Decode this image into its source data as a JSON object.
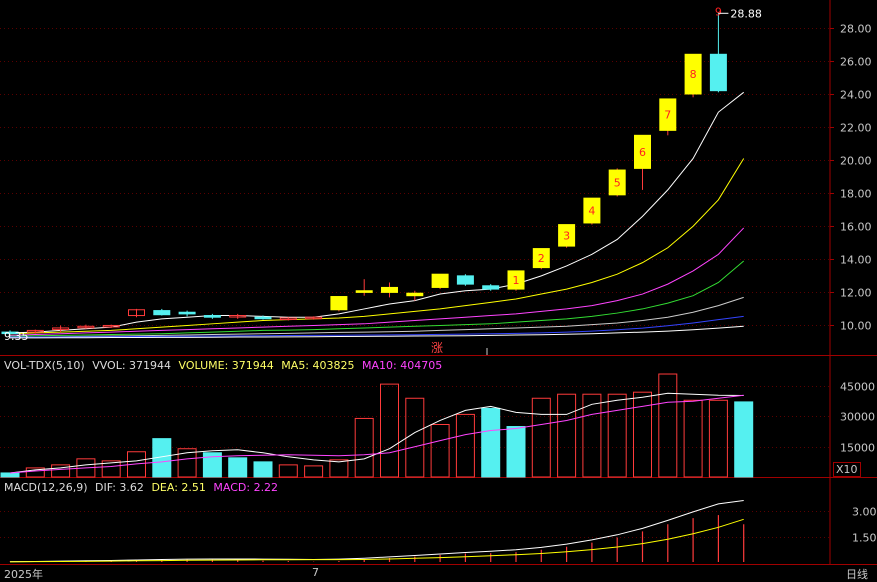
{
  "colors": {
    "up": "#ff3b3b",
    "down": "#55f0f0",
    "upFill": "#ffff00",
    "ma1": "#ffffff",
    "ma2": "#ffff00",
    "ma3": "#ff44ff",
    "ma4": "#33dd33",
    "ma5": "#cccccc",
    "ma6": "#3344ff",
    "grid": "#5a0000",
    "frame": "#a00000",
    "macdDif": "#ffffff",
    "macdDea": "#ffff00",
    "macdBar": "#ff3b3b"
  },
  "price": {
    "high_label": "28.88",
    "low_label": "9.35",
    "ticks": [
      "28.00",
      "26.00",
      "24.00",
      "22.00",
      "20.00",
      "18.00",
      "16.00",
      "14.00",
      "12.00",
      "10.00"
    ],
    "tick_values": [
      28,
      26,
      24,
      22,
      20,
      18,
      16,
      14,
      12,
      10
    ],
    "zhang_label": "涨"
  },
  "volume": {
    "indicator": "VOL-TDX(5,10)",
    "vvol_label": "VVOL: 371944",
    "volume_label": "VOLUME: 371944",
    "ma5_label": "MA5: 403825",
    "ma10_label": "MA10: 404705",
    "ticks": [
      "45000",
      "30000",
      "15000"
    ],
    "tick_values": [
      45000,
      30000,
      15000
    ],
    "unit_label": "X10"
  },
  "macd": {
    "indicator": "MACD(12,26,9)",
    "dif_label": "DIF: 3.62",
    "dea_label": "DEA: 2.51",
    "macd_label": "MACD: 2.22",
    "ticks": [
      "3.00",
      "1.50"
    ],
    "tick_values": [
      3.0,
      1.5
    ]
  },
  "footer": {
    "year_label": "2025年",
    "month_label": "7",
    "period_label": "日线"
  },
  "chart_data": {
    "type": "candlestick",
    "candles": [
      {
        "o": 9.6,
        "h": 9.7,
        "l": 9.45,
        "c": 9.55
      },
      {
        "o": 9.6,
        "h": 9.75,
        "l": 9.5,
        "c": 9.7
      },
      {
        "o": 9.75,
        "h": 10.0,
        "l": 9.6,
        "c": 9.85
      },
      {
        "o": 9.9,
        "h": 10.05,
        "l": 9.8,
        "c": 9.95
      },
      {
        "o": 9.95,
        "h": 10.05,
        "l": 9.85,
        "c": 10.0
      },
      {
        "o": 10.6,
        "h": 11.0,
        "l": 10.5,
        "c": 10.95
      },
      {
        "o": 10.9,
        "h": 11.0,
        "l": 10.6,
        "c": 10.65
      },
      {
        "o": 10.8,
        "h": 10.9,
        "l": 10.55,
        "c": 10.7
      },
      {
        "o": 10.6,
        "h": 10.7,
        "l": 10.4,
        "c": 10.5
      },
      {
        "o": 10.55,
        "h": 10.7,
        "l": 10.4,
        "c": 10.6
      },
      {
        "o": 10.5,
        "h": 10.6,
        "l": 10.35,
        "c": 10.45
      },
      {
        "o": 10.4,
        "h": 10.5,
        "l": 10.3,
        "c": 10.45
      },
      {
        "o": 10.45,
        "h": 10.55,
        "l": 10.35,
        "c": 10.5
      },
      {
        "o": 10.95,
        "h": 11.75,
        "l": 10.85,
        "c": 11.75
      },
      {
        "o": 12.0,
        "h": 12.8,
        "l": 11.8,
        "c": 12.1
      },
      {
        "o": 12.0,
        "h": 12.6,
        "l": 11.7,
        "c": 12.3
      },
      {
        "o": 11.8,
        "h": 12.1,
        "l": 11.5,
        "c": 11.95
      },
      {
        "o": 12.3,
        "h": 13.1,
        "l": 12.2,
        "c": 13.1
      },
      {
        "o": 13.0,
        "h": 13.1,
        "l": 12.4,
        "c": 12.5
      },
      {
        "o": 12.4,
        "h": 12.5,
        "l": 12.1,
        "c": 12.2
      },
      {
        "o": 12.2,
        "h": 13.3,
        "l": 12.1,
        "c": 13.3
      },
      {
        "o": 13.5,
        "h": 14.65,
        "l": 13.4,
        "c": 14.65
      },
      {
        "o": 14.8,
        "h": 16.1,
        "l": 14.7,
        "c": 16.1
      },
      {
        "o": 16.2,
        "h": 17.7,
        "l": 16.1,
        "c": 17.7
      },
      {
        "o": 17.9,
        "h": 19.5,
        "l": 17.8,
        "c": 19.4
      },
      {
        "o": 19.5,
        "h": 21.5,
        "l": 18.2,
        "c": 21.5
      },
      {
        "o": 21.8,
        "h": 23.7,
        "l": 21.5,
        "c": 23.7
      },
      {
        "o": 24.0,
        "h": 26.4,
        "l": 23.8,
        "c": 26.4
      },
      {
        "o": 26.4,
        "h": 28.88,
        "l": 24.1,
        "c": 24.2
      }
    ],
    "candle_marks": [
      "",
      "",
      "",
      "",
      "",
      "",
      "",
      "",
      "",
      "",
      "",
      "",
      "",
      "",
      "",
      "",
      "",
      "",
      "",
      "",
      "1",
      "2",
      "3",
      "4",
      "5",
      "6",
      "7",
      "8",
      "9"
    ],
    "ma_series": [
      {
        "values": [
          9.55,
          9.6,
          9.7,
          9.8,
          9.9,
          10.2,
          10.4,
          10.5,
          10.6,
          10.6,
          10.55,
          10.5,
          10.5,
          10.7,
          11.0,
          11.3,
          11.5,
          11.9,
          12.1,
          12.2,
          12.5,
          13.0,
          13.6,
          14.3,
          15.2,
          16.6,
          18.2,
          20.1,
          22.9,
          24.1
        ]
      },
      {
        "values": [
          9.5,
          9.55,
          9.6,
          9.65,
          9.7,
          9.8,
          9.9,
          10.0,
          10.1,
          10.2,
          10.3,
          10.35,
          10.4,
          10.45,
          10.55,
          10.7,
          10.85,
          11.0,
          11.2,
          11.4,
          11.6,
          11.9,
          12.2,
          12.6,
          13.1,
          13.8,
          14.7,
          16.0,
          17.6,
          20.1
        ]
      },
      {
        "values": [
          9.4,
          9.45,
          9.5,
          9.55,
          9.6,
          9.65,
          9.7,
          9.75,
          9.8,
          9.85,
          9.9,
          9.95,
          10.0,
          10.05,
          10.1,
          10.2,
          10.3,
          10.4,
          10.5,
          10.6,
          10.7,
          10.85,
          11.0,
          11.2,
          11.5,
          11.9,
          12.5,
          13.3,
          14.3,
          15.9
        ]
      },
      {
        "values": [
          9.35,
          9.38,
          9.4,
          9.42,
          9.45,
          9.48,
          9.5,
          9.55,
          9.6,
          9.65,
          9.7,
          9.72,
          9.75,
          9.8,
          9.85,
          9.9,
          9.95,
          10.0,
          10.05,
          10.1,
          10.2,
          10.3,
          10.4,
          10.55,
          10.75,
          11.0,
          11.35,
          11.8,
          12.6,
          13.9
        ]
      },
      {
        "values": [
          9.3,
          9.3,
          9.32,
          9.34,
          9.36,
          9.38,
          9.4,
          9.42,
          9.45,
          9.48,
          9.5,
          9.52,
          9.55,
          9.58,
          9.6,
          9.62,
          9.65,
          9.7,
          9.75,
          9.8,
          9.85,
          9.9,
          9.95,
          10.05,
          10.15,
          10.3,
          10.5,
          10.8,
          11.2,
          11.7
        ]
      },
      {
        "values": [
          9.3,
          9.3,
          9.3,
          9.31,
          9.32,
          9.33,
          9.34,
          9.35,
          9.36,
          9.37,
          9.38,
          9.39,
          9.4,
          9.41,
          9.42,
          9.43,
          9.44,
          9.46,
          9.48,
          9.5,
          9.52,
          9.55,
          9.6,
          9.66,
          9.74,
          9.84,
          9.98,
          10.15,
          10.35,
          10.55
        ]
      },
      {
        "values": [
          9.25,
          9.25,
          9.26,
          9.26,
          9.27,
          9.27,
          9.28,
          9.28,
          9.29,
          9.3,
          9.3,
          9.31,
          9.32,
          9.33,
          9.34,
          9.35,
          9.36,
          9.37,
          9.38,
          9.4,
          9.42,
          9.44,
          9.47,
          9.5,
          9.55,
          9.6,
          9.66,
          9.74,
          9.84,
          9.95
        ]
      }
    ],
    "volume_bars": [
      2000,
      4500,
      6000,
      9000,
      8000,
      12500,
      19000,
      14000,
      12000,
      9500,
      7500,
      6000,
      5500,
      8500,
      29000,
      46000,
      39000,
      26000,
      31000,
      34000,
      25000,
      39000,
      41000,
      41000,
      41000,
      42000,
      51000,
      38000,
      38000,
      37194
    ],
    "volume_up": [
      false,
      true,
      true,
      true,
      true,
      true,
      false,
      true,
      false,
      false,
      false,
      true,
      true,
      true,
      true,
      true,
      true,
      true,
      true,
      false,
      false,
      true,
      true,
      true,
      true,
      true,
      true,
      true,
      true,
      false
    ],
    "vol_ma5": [
      2000,
      3500,
      4500,
      6000,
      7000,
      8000,
      10000,
      12000,
      13000,
      13500,
      12000,
      10000,
      8500,
      7500,
      9000,
      14000,
      22000,
      28000,
      33000,
      35000,
      32000,
      31000,
      31000,
      36000,
      38000,
      39500,
      41500,
      41000,
      40500,
      40383
    ],
    "vol_ma10": [
      2000,
      3000,
      3800,
      4500,
      5200,
      6500,
      7500,
      9000,
      10000,
      10500,
      10800,
      11000,
      10800,
      10500,
      11000,
      12000,
      15000,
      18000,
      21000,
      23000,
      24000,
      26000,
      28000,
      31000,
      33000,
      35000,
      37000,
      37500,
      39000,
      40470
    ],
    "macd_dif": [
      0.02,
      0.03,
      0.05,
      0.07,
      0.09,
      0.12,
      0.15,
      0.17,
      0.18,
      0.18,
      0.17,
      0.16,
      0.15,
      0.17,
      0.22,
      0.3,
      0.38,
      0.47,
      0.56,
      0.63,
      0.72,
      0.86,
      1.05,
      1.3,
      1.6,
      1.98,
      2.45,
      2.95,
      3.42,
      3.62
    ],
    "macd_dea": [
      0.01,
      0.02,
      0.03,
      0.04,
      0.05,
      0.07,
      0.08,
      0.1,
      0.11,
      0.12,
      0.13,
      0.13,
      0.14,
      0.14,
      0.15,
      0.18,
      0.22,
      0.26,
      0.31,
      0.37,
      0.43,
      0.5,
      0.6,
      0.73,
      0.88,
      1.08,
      1.34,
      1.66,
      2.04,
      2.51
    ],
    "macd_hist": [
      0.02,
      0.02,
      0.04,
      0.06,
      0.08,
      0.1,
      0.14,
      0.14,
      0.14,
      0.12,
      0.08,
      0.06,
      0.02,
      0.06,
      0.14,
      0.24,
      0.32,
      0.42,
      0.5,
      0.52,
      0.58,
      0.72,
      0.9,
      1.14,
      1.44,
      1.8,
      2.22,
      2.58,
      2.76,
      2.22
    ]
  }
}
